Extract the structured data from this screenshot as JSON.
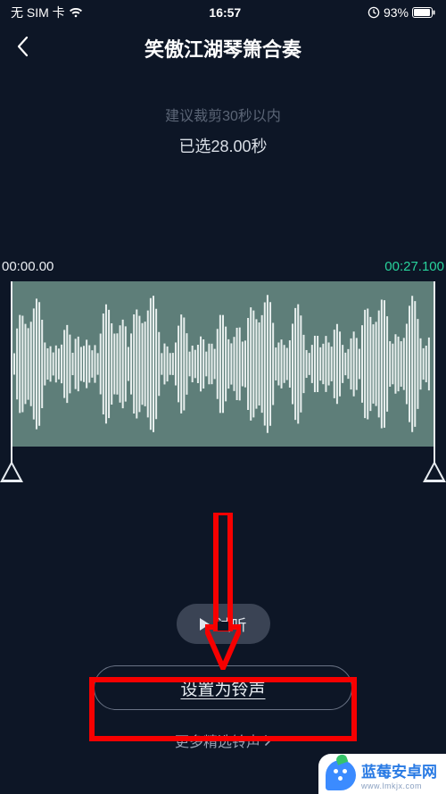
{
  "status": {
    "carrier": "无 SIM 卡",
    "time": "16:57",
    "battery": "93%"
  },
  "header": {
    "title": "笑傲江湖琴箫合奏"
  },
  "hints": {
    "suggest": "建议裁剪30秒以内",
    "selected": "已选28.00秒"
  },
  "editor": {
    "start_time": "00:00.00",
    "end_time": "00:27.100"
  },
  "controls": {
    "preview": "试听",
    "set_ringtone": "设置为铃声",
    "more": "更多精选铃声"
  },
  "watermark": {
    "name": "蓝莓安卓网",
    "url": "www.lmkjx.com"
  }
}
